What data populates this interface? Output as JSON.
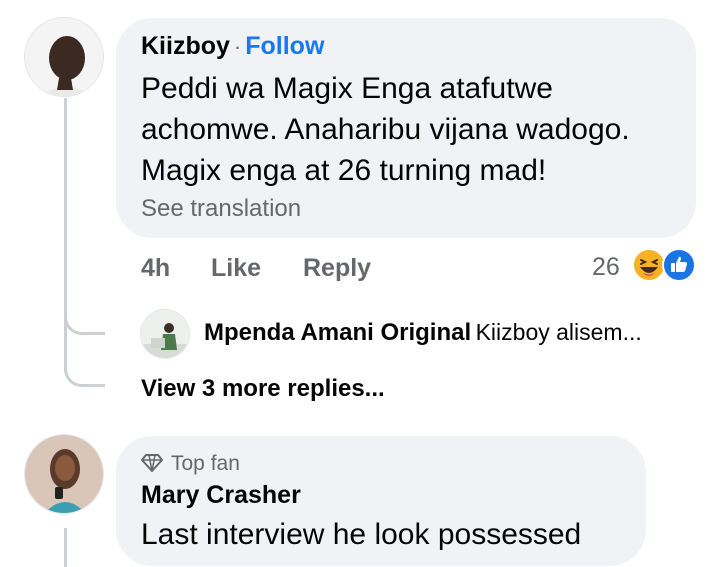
{
  "comments": [
    {
      "author": "Kiizboy",
      "follow_separator": "·",
      "follow_label": "Follow",
      "lines": [
        "Peddi wa Magix Enga atafutwe",
        "achomwe. Anaharibu vijana wadogo.",
        "Magix enga at 26 turning mad!"
      ],
      "see_translation": "See translation",
      "time": "4h",
      "like_label": "Like",
      "reply_label": "Reply",
      "reaction_count": "26",
      "reaction_icons": [
        "haha-icon",
        "like-icon"
      ],
      "reply_preview": {
        "author": "Mpenda Amani Original",
        "snippet": "Kiizboy alisem..."
      },
      "more_replies": "View 3 more replies..."
    },
    {
      "badge": "Top fan",
      "author": "Mary Crasher",
      "text": "Last interview he look possessed"
    }
  ],
  "colors": {
    "bubble": "#f0f2f5",
    "link_blue": "#1877f2",
    "secondary_text": "#65676b",
    "haha_yellow": "#f7b125",
    "like_blue": "#1b74e4"
  }
}
